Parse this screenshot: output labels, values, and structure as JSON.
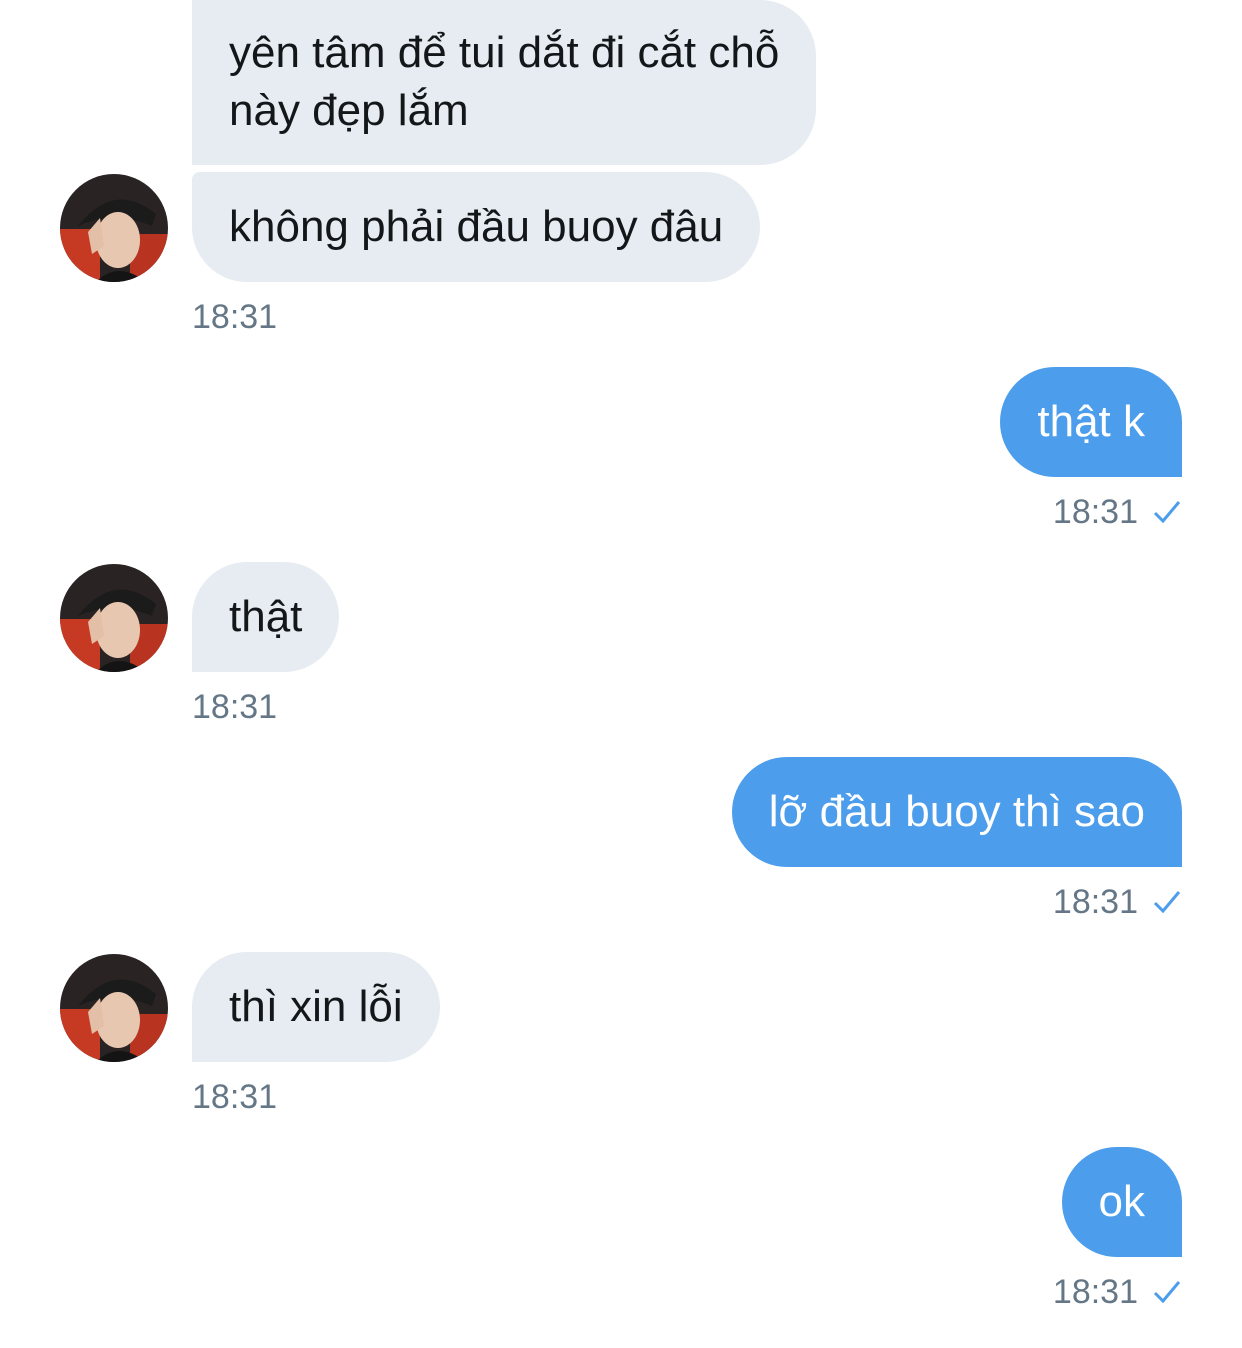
{
  "colors": {
    "incoming_bubble": "#e6ecf1",
    "outgoing_bubble": "#4c9deb",
    "timestamp": "#657786",
    "check": "#4c9deb"
  },
  "messages": [
    {
      "direction": "incoming",
      "lines": [
        "yên tâm để tui dắt đi cắt chỗ",
        "này đẹp lắm"
      ]
    },
    {
      "direction": "incoming",
      "lines": [
        "không phải đầu buoy đâu"
      ],
      "time": "18:31"
    },
    {
      "direction": "outgoing",
      "lines": [
        "thật k"
      ],
      "time": "18:31",
      "status_icon": "check-icon"
    },
    {
      "direction": "incoming",
      "lines": [
        "thật"
      ],
      "time": "18:31"
    },
    {
      "direction": "outgoing",
      "lines": [
        "lỡ đầu buoy thì sao"
      ],
      "time": "18:31",
      "status_icon": "check-icon"
    },
    {
      "direction": "incoming",
      "lines": [
        "thì xin lỗi"
      ],
      "time": "18:31"
    },
    {
      "direction": "outgoing",
      "lines": [
        "ok"
      ],
      "time": "18:31",
      "status_icon": "check-icon"
    }
  ]
}
